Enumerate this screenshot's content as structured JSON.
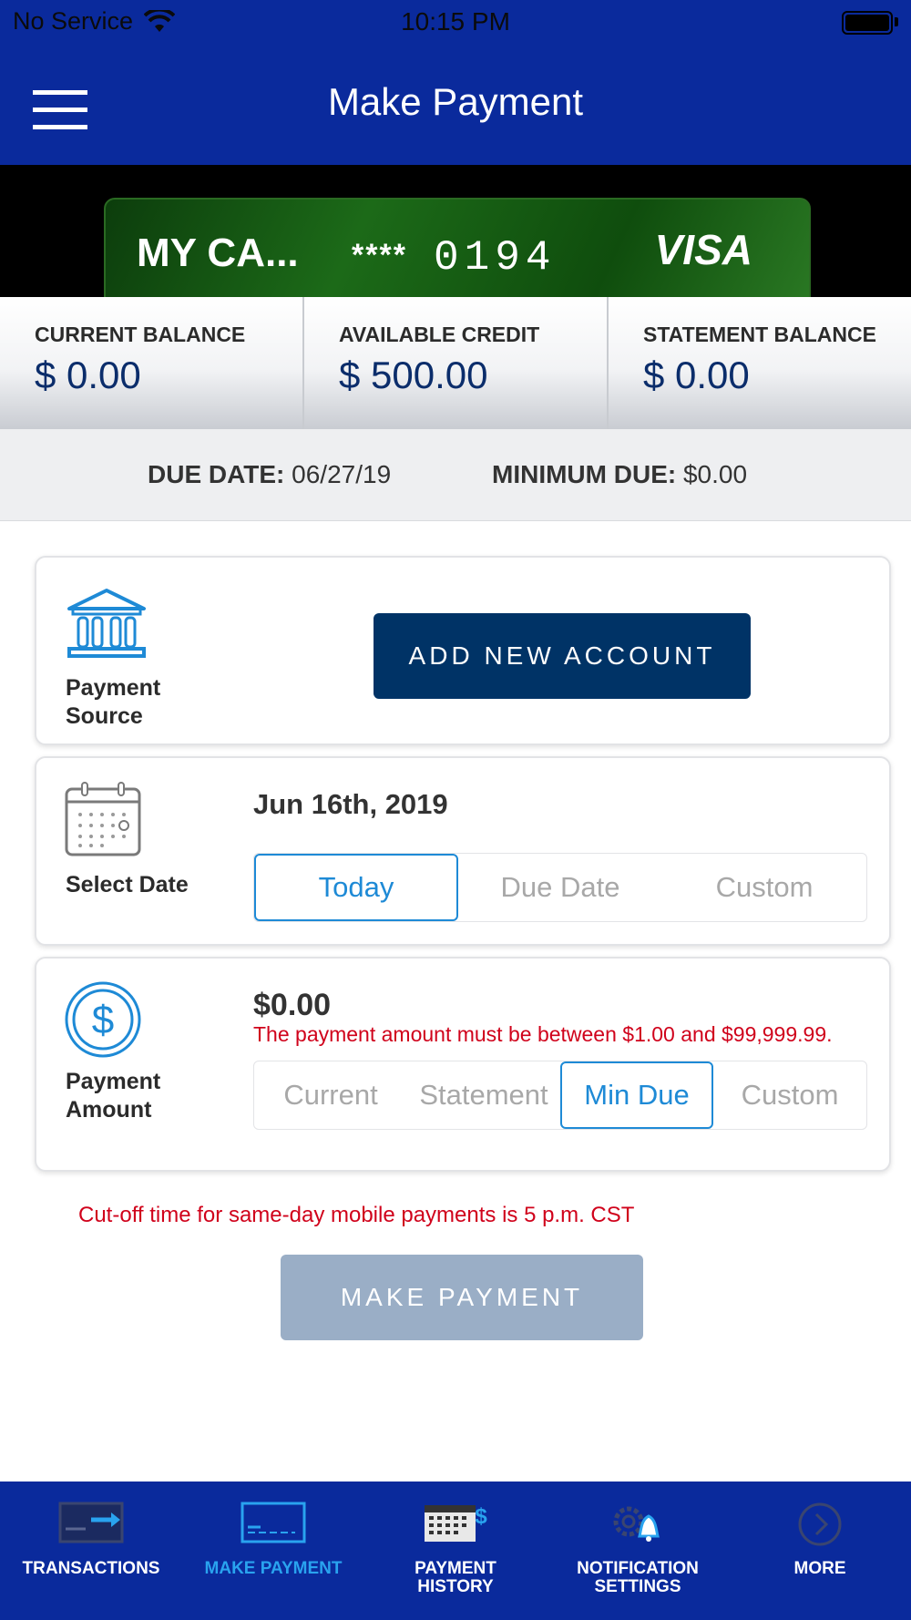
{
  "status_bar": {
    "carrier": "No Service",
    "time": "10:15 PM"
  },
  "header": {
    "title": "Make Payment"
  },
  "card": {
    "name": "MY CA...",
    "masked": "****",
    "last_digits": "0194",
    "brand": "VISA"
  },
  "balances": [
    {
      "label": "CURRENT BALANCE",
      "value": "$ 0.00"
    },
    {
      "label": "AVAILABLE CREDIT",
      "value": "$ 500.00"
    },
    {
      "label": "STATEMENT BALANCE",
      "value": "$ 0.00"
    }
  ],
  "due": {
    "due_date_label": "DUE DATE:",
    "due_date_value": "06/27/19",
    "min_due_label": "MINIMUM DUE:",
    "min_due_value": "$0.00"
  },
  "payment_source": {
    "label_line1": "Payment",
    "label_line2": "Source",
    "add_account_label": "ADD NEW ACCOUNT"
  },
  "select_date": {
    "label": "Select Date",
    "value": "Jun 16th, 2019",
    "options": [
      "Today",
      "Due Date",
      "Custom"
    ],
    "selected": "Today"
  },
  "payment_amount": {
    "label_line1": "Payment",
    "label_line2": "Amount",
    "value": "$0.00",
    "error": "The payment amount must be between $1.00 and $99,999.99.",
    "options": [
      "Current",
      "Statement",
      "Min Due",
      "Custom"
    ],
    "selected": "Min Due"
  },
  "cutoff_notice": "Cut-off time for same-day mobile payments is 5 p.m. CST",
  "make_payment_label": "MAKE PAYMENT",
  "tabs": [
    {
      "label": "TRANSACTIONS",
      "icon": "transactions-icon"
    },
    {
      "label": "MAKE PAYMENT",
      "icon": "card-payment-icon",
      "active": true
    },
    {
      "label_line1": "PAYMENT",
      "label_line2": "HISTORY",
      "icon": "calendar-dollar-icon"
    },
    {
      "label_line1": "NOTIFICATION",
      "label_line2": "SETTINGS",
      "icon": "gear-bell-icon"
    },
    {
      "label": "MORE",
      "icon": "chevron-right-circle-icon"
    }
  ],
  "colors": {
    "brand_blue": "#0a2a9c",
    "button_navy": "#003366",
    "accent": "#1e8ad6",
    "error_red": "#d0021b",
    "disabled_button": "#9aaec6"
  }
}
